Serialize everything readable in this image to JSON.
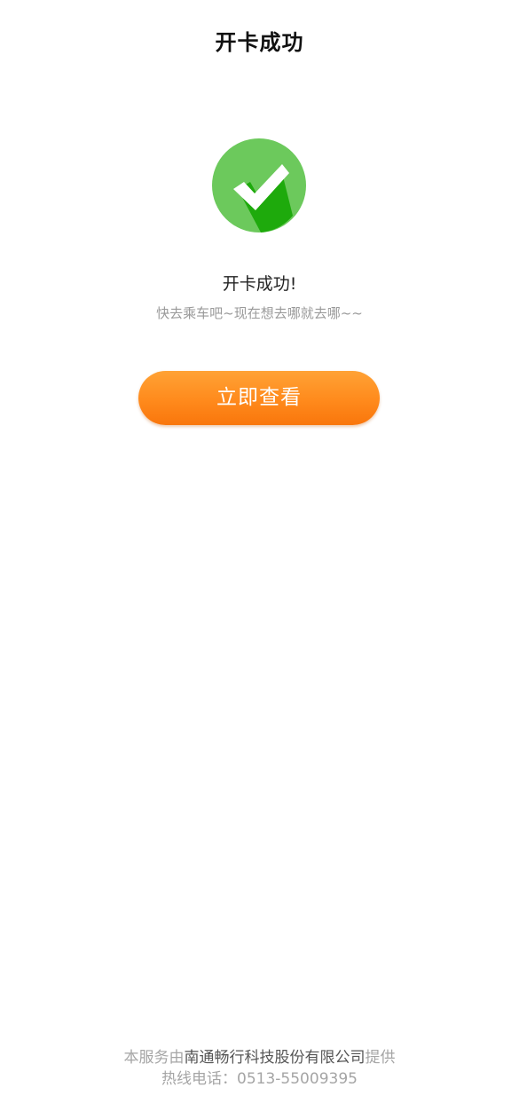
{
  "header": {
    "title": "开卡成功"
  },
  "result": {
    "icon": "check-circle-icon",
    "title": "开卡成功!",
    "subtitle": "快去乘车吧~现在想去哪就去哪~~",
    "colors": {
      "icon_light": "#6cc95c",
      "icon_dark": "#1eaa0c"
    }
  },
  "action": {
    "view_label": "立即查看",
    "color": "#ff8a1c"
  },
  "footer": {
    "provider_prefix": "本服务由",
    "company": "南通畅行科技股份有限公司",
    "provider_suffix": "提供",
    "hotline": "热线电话：0513-55009395"
  }
}
